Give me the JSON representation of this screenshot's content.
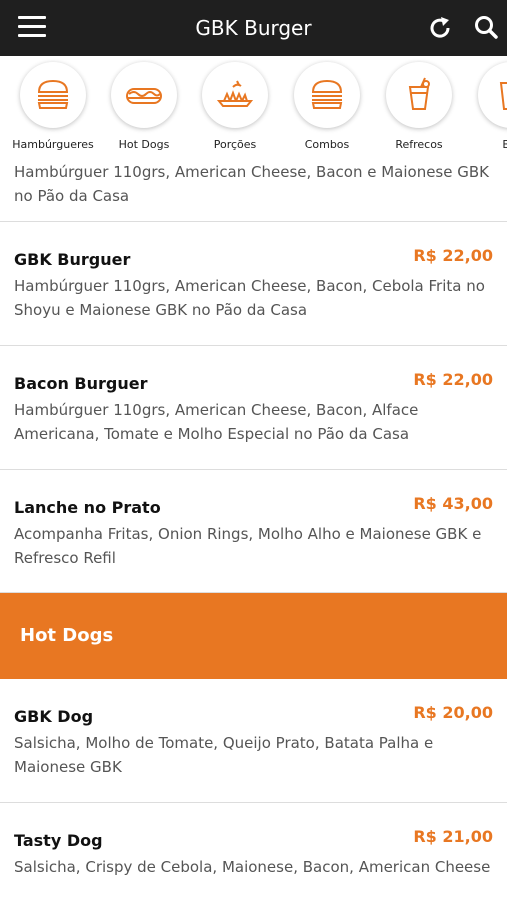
{
  "header": {
    "title": "GBK Burger",
    "menu_icon": "hamburger-menu-icon",
    "refresh_icon": "refresh-icon",
    "search_icon": "search-icon",
    "bg_color": "#1f1f1f"
  },
  "categories": [
    {
      "label": "Hambúrgueres",
      "icon": "burger-icon"
    },
    {
      "label": "Hot Dogs",
      "icon": "hotdog-icon"
    },
    {
      "label": "Porções",
      "icon": "portion-plate-icon"
    },
    {
      "label": "Combos",
      "icon": "burger-icon"
    },
    {
      "label": "Refrecos",
      "icon": "drink-icon"
    },
    {
      "label": "Bel",
      "icon": "cup-icon"
    }
  ],
  "accent_color": "#e87722",
  "menu": {
    "partial_item": {
      "description": "Hambúrguer 110grs, American Cheese, Bacon e Maionese GBK no Pão da Casa"
    },
    "items": [
      {
        "name": "GBK Burguer",
        "price": "R$ 22,00",
        "description": "Hambúrguer 110grs, American Cheese, Bacon, Cebola Frita no Shoyu e Maionese GBK no Pão da Casa"
      },
      {
        "name": "Bacon Burguer",
        "price": "R$ 22,00",
        "description": "Hambúrguer 110grs, American Cheese, Bacon, Alface Americana, Tomate e Molho Especial no Pão da Casa"
      },
      {
        "name": "Lanche no Prato",
        "price": "R$ 43,00",
        "description": "Acompanha Fritas, Onion Rings, Molho Alho e Maionese GBK e Refresco Refil"
      }
    ],
    "section": {
      "title": "Hot Dogs"
    },
    "section_items": [
      {
        "name": "GBK Dog",
        "price": "R$ 20,00",
        "description": "Salsicha, Molho de Tomate, Queijo Prato, Batata Palha e Maionese GBK"
      },
      {
        "name": "Tasty Dog",
        "price": "R$ 21,00",
        "description": "Salsicha, Crispy de Cebola, Maionese, Bacon, American Cheese"
      }
    ]
  }
}
